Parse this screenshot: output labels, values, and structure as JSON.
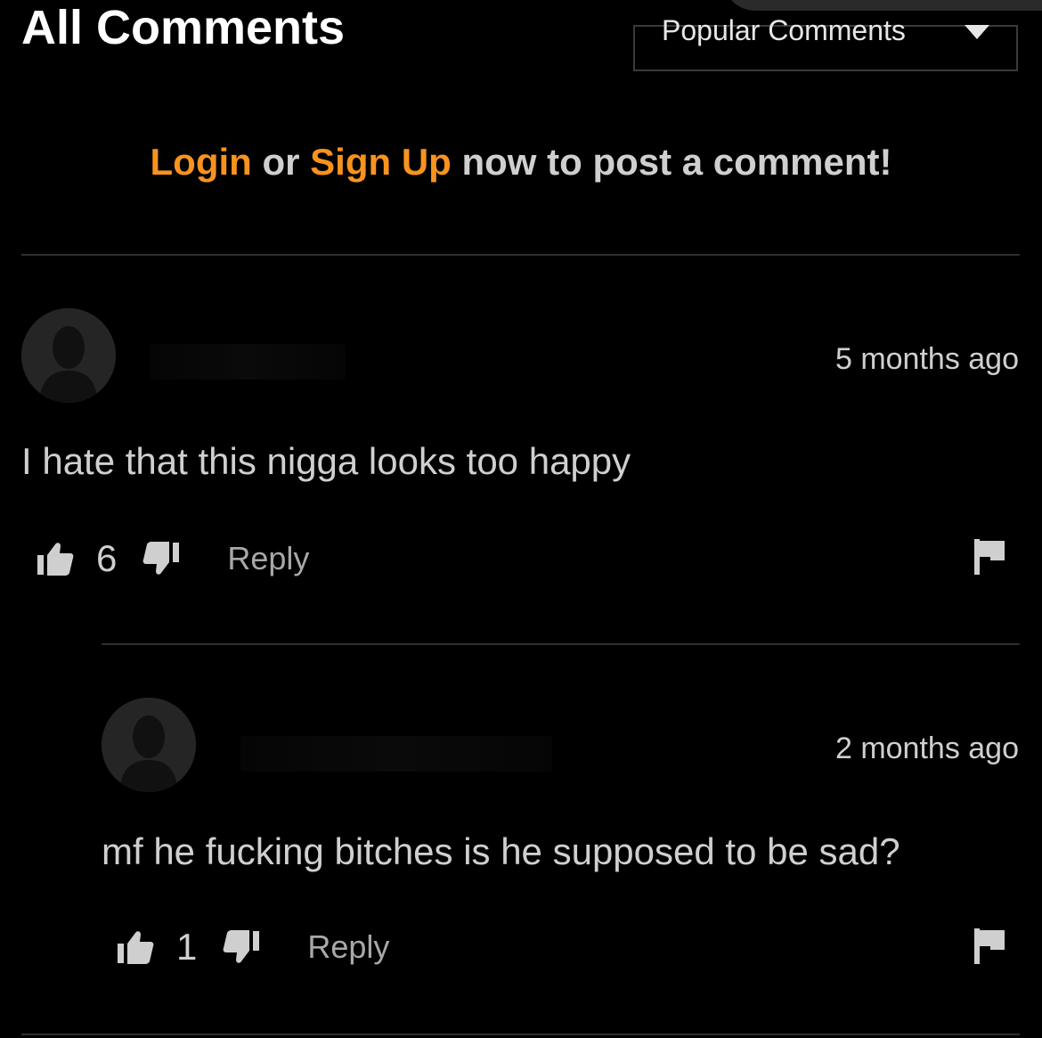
{
  "header": {
    "title": "All Comments",
    "sort": {
      "selected": "Popular Comments"
    }
  },
  "login_prompt": {
    "login": "Login",
    "or": " or ",
    "signup": "Sign Up",
    "rest": " now to post a comment!",
    "accent_color": "#f7931e"
  },
  "comments": [
    {
      "time": "5 months ago",
      "text": "I hate that this nigga looks too happy",
      "likes": "6",
      "reply_label": "Reply"
    },
    {
      "time": "2 months ago",
      "text": "mf he fucking bitches is he supposed to be sad?",
      "likes": "1",
      "reply_label": "Reply"
    }
  ]
}
